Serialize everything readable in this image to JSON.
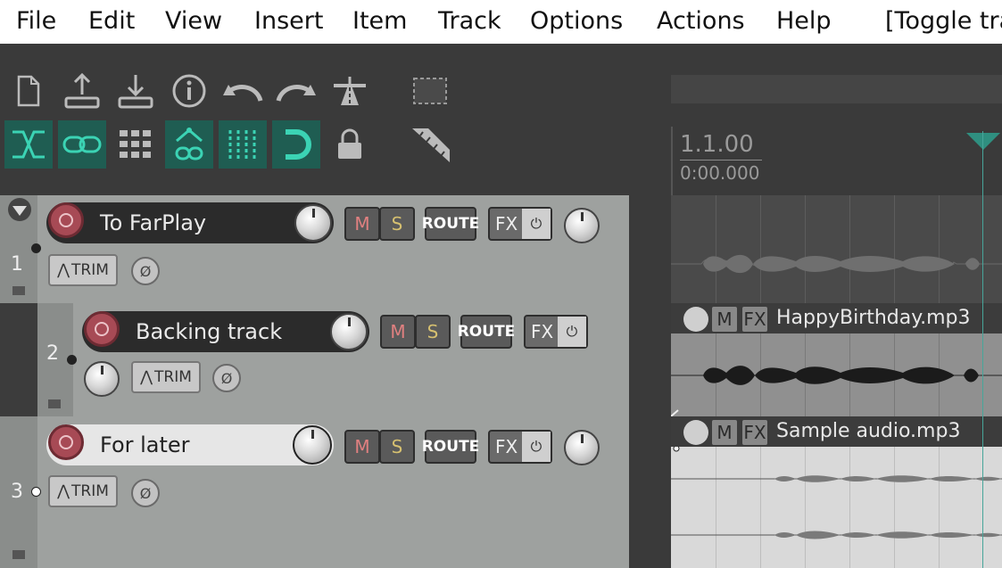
{
  "menu": [
    "File",
    "Edit",
    "View",
    "Insert",
    "Item",
    "Track",
    "Options",
    "Actions",
    "Help",
    "[Toggle tra"
  ],
  "ruler": {
    "position_bars": "1.1.00",
    "position_time": "0:00.000"
  },
  "tracks": [
    {
      "number": "1",
      "name": "To FarPlay",
      "m": "M",
      "s": "S",
      "route": "ROUTE",
      "fx": "FX",
      "trim": "TRIM",
      "phase": "Ø",
      "power": "⏻"
    },
    {
      "number": "2",
      "name": "Backing track",
      "m": "M",
      "s": "S",
      "route": "ROUTE",
      "fx": "FX",
      "trim": "TRIM",
      "phase": "Ø",
      "power": "⏻"
    },
    {
      "number": "3",
      "name": "For later",
      "m": "M",
      "s": "S",
      "route": "ROUTE",
      "fx": "FX",
      "trim": "TRIM",
      "phase": "Ø",
      "power": "⏻"
    }
  ],
  "items": [
    {
      "name": "HappyBirthday.mp3",
      "m": "M",
      "fx": "FX"
    },
    {
      "name": "Sample audio.mp3",
      "m": "M",
      "fx": "FX"
    }
  ],
  "toolbar_icons": [
    "new-project-icon",
    "save-upload-icon",
    "open-download-icon",
    "info-icon",
    "undo-icon",
    "redo-icon",
    "metronome-road-icon",
    "marquee-select-icon",
    "crossfade-icon",
    "link-icon",
    "grid-icon",
    "item-grouping-icon",
    "snap-grid-icon",
    "snap-magnet-icon",
    "lock-icon",
    "ruler-ripple-icon"
  ],
  "colors": {
    "toggle_on": "#1f5d52",
    "accent": "#47a59a",
    "rec": "#a74a55",
    "tcp": "#9ea19f"
  }
}
